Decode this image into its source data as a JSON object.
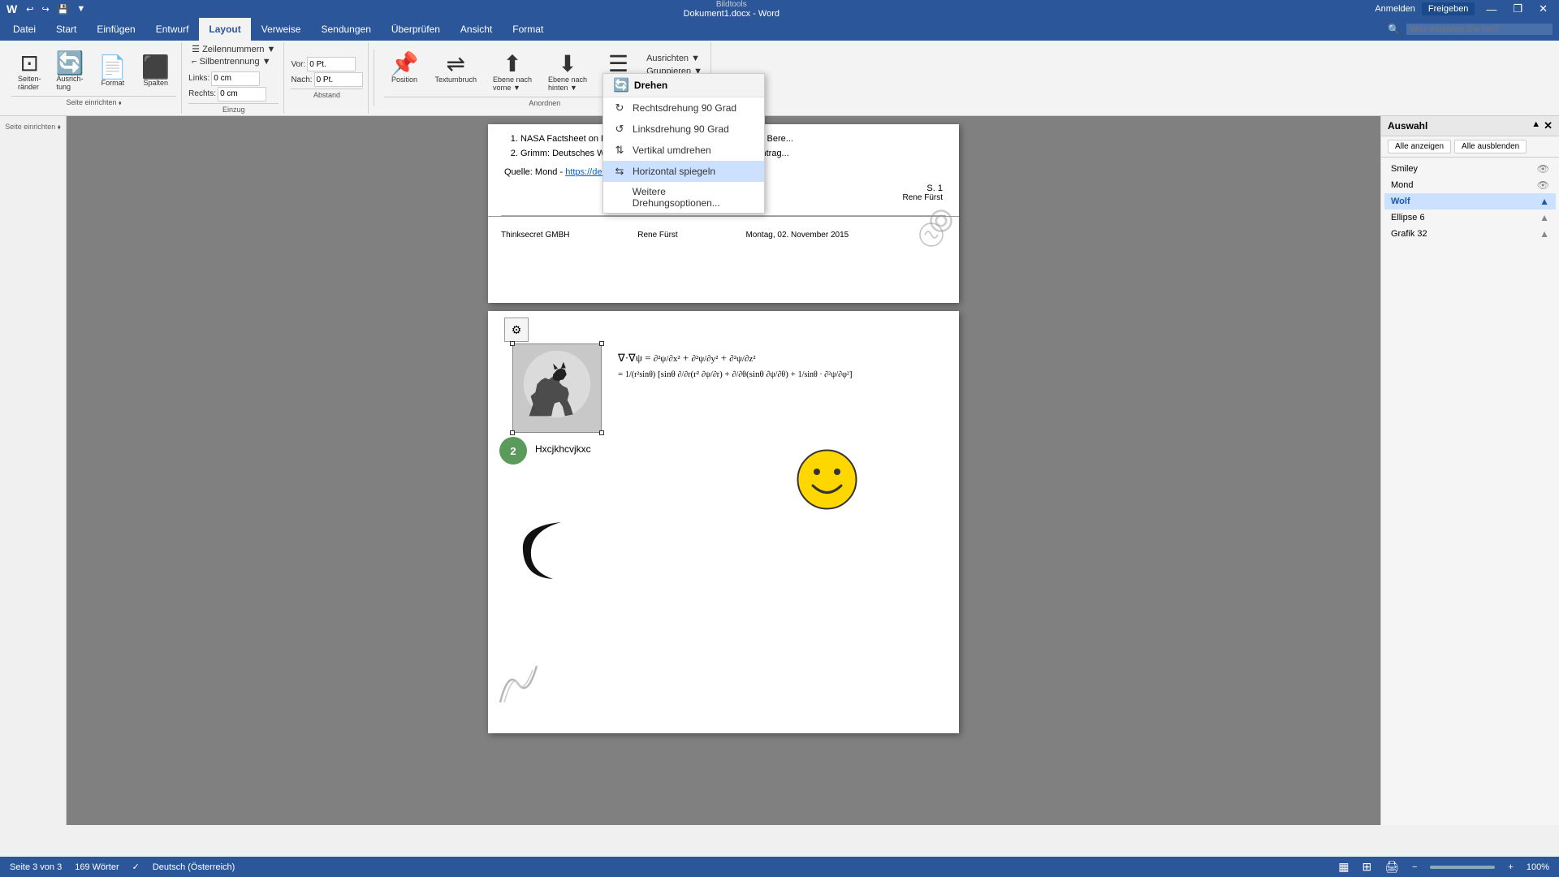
{
  "titlebar": {
    "title": "Dokument1.docx - Word",
    "app": "Bildtools",
    "left_icons": [
      "◄",
      "►",
      "💾",
      "↩"
    ],
    "right_btns": [
      "—",
      "❐",
      "✕"
    ],
    "user_actions": [
      "Anmelden",
      "Freigeben"
    ]
  },
  "tabs": [
    {
      "label": "Datei",
      "active": false
    },
    {
      "label": "Start",
      "active": false
    },
    {
      "label": "Einfügen",
      "active": false
    },
    {
      "label": "Entwurf",
      "active": false
    },
    {
      "label": "Layout",
      "active": true
    },
    {
      "label": "Verweise",
      "active": false
    },
    {
      "label": "Sendungen",
      "active": false
    },
    {
      "label": "Überprüfen",
      "active": false
    },
    {
      "label": "Ansicht",
      "active": false
    },
    {
      "label": "Format",
      "active": false
    }
  ],
  "search": {
    "placeholder": "Was möchten Sie tun?"
  },
  "toolbar": {
    "groups": [
      {
        "name": "Seite einrichten",
        "items": [
          {
            "label": "Seiten-\nränder",
            "icon": "⊞"
          },
          {
            "label": "Ausrich-\ntung",
            "icon": "🔄"
          },
          {
            "label": "Format",
            "icon": "📄"
          },
          {
            "label": "Spalten",
            "icon": "⬛"
          }
        ]
      },
      {
        "name": "Einzug",
        "rows": [
          {
            "label": "Links:",
            "value": "0 cm"
          },
          {
            "label": "Rechts:",
            "value": "0 cm"
          }
        ]
      },
      {
        "name": "Abstand",
        "rows": [
          {
            "label": "Vor:",
            "value": "0 Pt."
          },
          {
            "label": "Nach:",
            "value": "0 Pt."
          },
          {
            "label": "Zeilennummern",
            "dropdown": true
          },
          {
            "label": "Silbentrennung",
            "dropdown": true
          }
        ]
      },
      {
        "name": "Anordnen",
        "items": [
          {
            "label": "Position",
            "icon": "📌"
          },
          {
            "label": "Textumbruch",
            "icon": "↕"
          },
          {
            "label": "Ebene nach\nvorne",
            "icon": "⬆"
          },
          {
            "label": "Ebene nach\nhinten",
            "icon": "⬇"
          },
          {
            "label": "Auswahl-\nbereich",
            "icon": "☰"
          }
        ],
        "extra": [
          {
            "label": "Ausrichten",
            "dropdown": true
          },
          {
            "label": "Gruppieren",
            "dropdown": true
          },
          {
            "label": "Drehen",
            "dropdown": true,
            "active": true
          }
        ]
      }
    ]
  },
  "dropdown": {
    "title": "Drehen",
    "items": [
      {
        "label": "Rechtsdrehung 90 Grad",
        "icon": "↻",
        "active": false
      },
      {
        "label": "Linksdrehung 90 Grad",
        "icon": "↺",
        "active": false
      },
      {
        "label": "Vertikal umdrehen",
        "icon": "⇅",
        "active": false
      },
      {
        "label": "Horizontal spiegeln",
        "icon": "⇆",
        "active": true
      },
      {
        "label": "Weitere Drehungsoptionen...",
        "icon": "",
        "active": false
      }
    ]
  },
  "document": {
    "page1_content": {
      "list": [
        "NASA Factsheet on Earth's moons (Englisch) und elementare Bere...",
        "Grimm: Deutsches Wörterbuch, als DWB digital verfügbar, Eintrag..."
      ],
      "source": "Quelle: Mond - https://de.wikipedia.org",
      "page_number": "S. 1",
      "author": "Rene Fürst"
    },
    "footer": {
      "company": "Thinksecret GMBH",
      "author": "Rene Fürst",
      "date": "Montag, 02. November 2015"
    },
    "page2_content": {
      "text_label": "Hxcjkhcvjkxc",
      "formula_lines": [
        "∇·∇ψ = ∂²ψ/∂x² + ∂²ψ/∂y² + ∂²ψ/∂z²",
        "= 1/(r²sinθ) [sinθ ∂/∂r(r² ∂ψ/∂r) + ∂/∂θ(sinθ ∂ψ/∂θ) + 1/sinθ ∂²ψ/∂φ²]"
      ]
    }
  },
  "right_panel": {
    "title": "Auswahl",
    "btn_show_all": "Alle anzeigen",
    "btn_hide_all": "Alle ausblenden",
    "items": [
      {
        "label": "Smiley",
        "active": false
      },
      {
        "label": "Mond",
        "active": false
      },
      {
        "label": "Wolf",
        "active": true
      },
      {
        "label": "Ellipse 6",
        "active": false
      },
      {
        "label": "Grafik 32",
        "active": false
      }
    ]
  },
  "statusbar": {
    "page_info": "Seite 3 von 3",
    "word_count": "169 Wörter",
    "language": "Deutsch (Österreich)"
  }
}
